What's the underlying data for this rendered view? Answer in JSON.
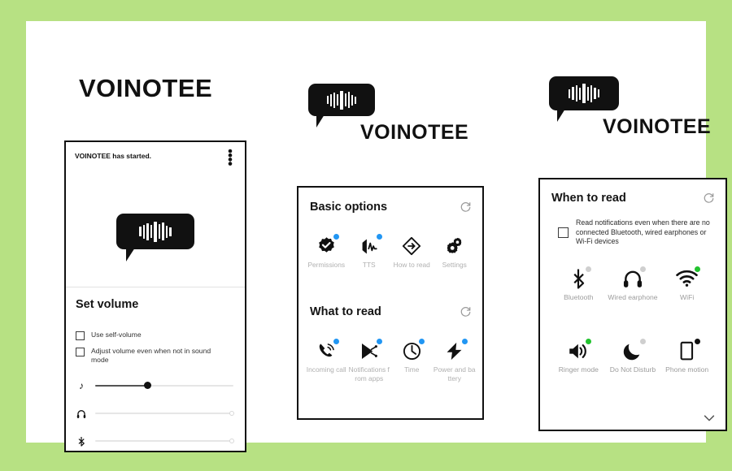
{
  "page": {
    "background_color": "#b7e183",
    "card_color": "#ffffff",
    "accent_blue": "#2196f3",
    "accent_green": "#22c32e",
    "accent_gray": "#cfcfcf"
  },
  "brand": {
    "wordmark": "VOINOTEE",
    "logo_icon": "speech-bubble-waveform-icon"
  },
  "panel1": {
    "status_text": "VOINOTEE has started.",
    "menu_icon": "vertical-more-icon",
    "logo_icon": "speech-bubble-waveform-icon",
    "section_title": "Set volume",
    "checkboxes": [
      {
        "label": "Use self-volume",
        "checked": false
      },
      {
        "label": "Adjust volume even when not in sound mode",
        "checked": false
      }
    ],
    "sliders": [
      {
        "icon": "music-note-icon",
        "glyph": "♪",
        "value": 38,
        "active": true
      },
      {
        "icon": "headphones-icon",
        "glyph": "Ἲ7",
        "value": 100,
        "active": false
      },
      {
        "icon": "bluetooth-icon",
        "glyph": "ᛩ",
        "value": 100,
        "active": false
      }
    ]
  },
  "panel2": {
    "sections": [
      {
        "title": "Basic options",
        "refresh_icon": "refresh-icon",
        "items": [
          {
            "label": "Permissions",
            "icon": "verified-badge-icon",
            "dot": "blue"
          },
          {
            "label": "TTS",
            "icon": "speaker-waveform-icon",
            "dot": "blue"
          },
          {
            "label": "How to read",
            "icon": "diamond-arrow-icon",
            "dot": "none"
          },
          {
            "label": "Settings",
            "icon": "gears-icon",
            "dot": "none"
          }
        ]
      },
      {
        "title": "What to read",
        "refresh_icon": "refresh-icon",
        "items": [
          {
            "label": "Incoming call",
            "icon": "phone-ring-icon",
            "dot": "blue"
          },
          {
            "label": "Notifications from apps",
            "icon": "play-store-icon",
            "dot": "blue"
          },
          {
            "label": "Time",
            "icon": "clock-icon",
            "dot": "blue"
          },
          {
            "label": "Power and battery",
            "icon": "lightning-bolt-icon",
            "dot": "blue"
          }
        ]
      }
    ]
  },
  "panel3": {
    "title": "When to read",
    "refresh_icon": "refresh-icon",
    "checkbox": {
      "label": "Read notifications even when there are no connected Bluetooth, wired earphones or Wi-Fi devices",
      "checked": false
    },
    "items_row1": [
      {
        "label": "Bluetooth",
        "icon": "bluetooth-icon",
        "dot": "gray"
      },
      {
        "label": "Wired earphone",
        "icon": "headphones-icon",
        "dot": "gray"
      },
      {
        "label": "WiFi",
        "icon": "wifi-icon",
        "dot": "green"
      }
    ],
    "items_row2": [
      {
        "label": "Ringer mode",
        "icon": "speaker-volume-icon",
        "dot": "green"
      },
      {
        "label": "Do Not Disturb",
        "icon": "crescent-moon-icon",
        "dot": "gray"
      },
      {
        "label": "Phone motion",
        "icon": "phone-motion-icon",
        "dot": "black"
      }
    ],
    "expand_icon": "chevron-down-icon"
  }
}
